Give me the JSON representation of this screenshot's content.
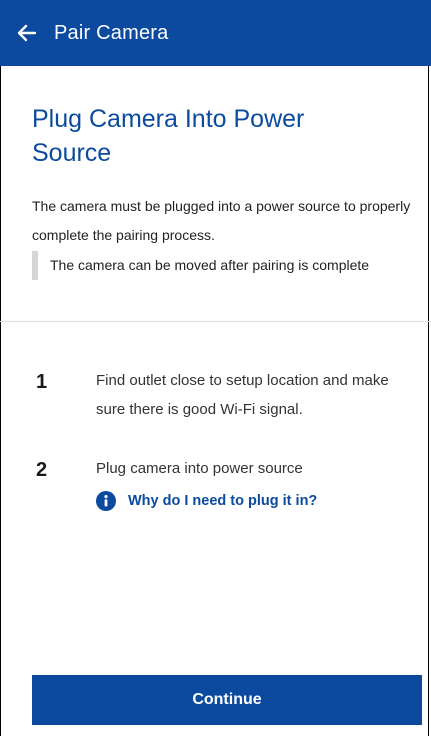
{
  "appbar": {
    "title": "Pair Camera",
    "back_icon": "arrow-left-icon"
  },
  "main": {
    "title": "Plug Camera Into Power Source",
    "description": "The camera must be plugged into a power source to properly complete the pairing process.",
    "note": "The camera can be moved after pairing is complete"
  },
  "steps": [
    {
      "number": "1",
      "text": "Find outlet close to setup location and make sure there is good Wi-Fi signal."
    },
    {
      "number": "2",
      "text": "Plug camera into power source"
    }
  ],
  "help_link": {
    "icon": "info-icon",
    "label": "Why do I need to plug it in?"
  },
  "footer": {
    "continue_label": "Continue"
  },
  "colors": {
    "brand": "#0b4a9e",
    "note_bar": "#d6d6d6"
  }
}
